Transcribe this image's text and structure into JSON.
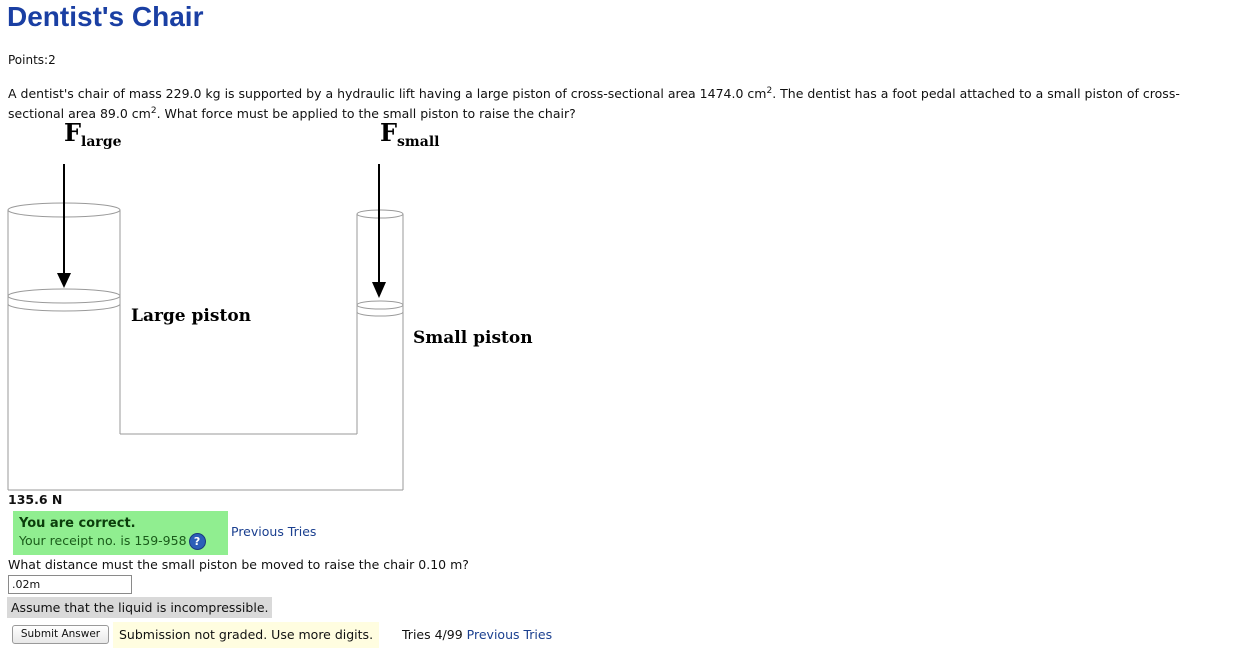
{
  "page": {
    "title": "Dentist's Chair",
    "points": "Points:2"
  },
  "problem": {
    "text_a": "A dentist's chair of mass 229.0 kg is supported by a hydraulic lift having a large piston of cross-sectional area 1474.0 cm",
    "sup_a": "2",
    "text_b": ". The dentist has a foot pedal attached to a small piston of cross-sectional area 89.0 cm",
    "sup_b": "2",
    "text_c": ". What force must be applied to the small piston to raise the chair?"
  },
  "figure": {
    "f_symbol": "F",
    "f_large_sub": "large",
    "f_small_sub": "small",
    "large_piston_label": "Large piston",
    "small_piston_label": "Small piston"
  },
  "part1": {
    "answer": "135.6 N",
    "correct_title": "You are correct.",
    "receipt": "Your receipt no. is 159-958",
    "help_icon": "question-circle-icon",
    "previous_tries": "Previous Tries"
  },
  "part2": {
    "question": "What distance must the small piston be moved to raise the chair 0.10 m?",
    "input_value": ".02m",
    "hint": "Assume that the liquid is incompressible.",
    "submit_label": "Submit Answer",
    "status": "Submission not graded. Use more digits.",
    "tries": "Tries 4/99",
    "previous_tries": "Previous Tries"
  },
  "colors": {
    "title": "#1a3fa3",
    "correct_bg": "#90ee90",
    "hint_bg": "#d9d9d9",
    "status_bg": "#fffde0",
    "link": "#1a3f8f"
  }
}
